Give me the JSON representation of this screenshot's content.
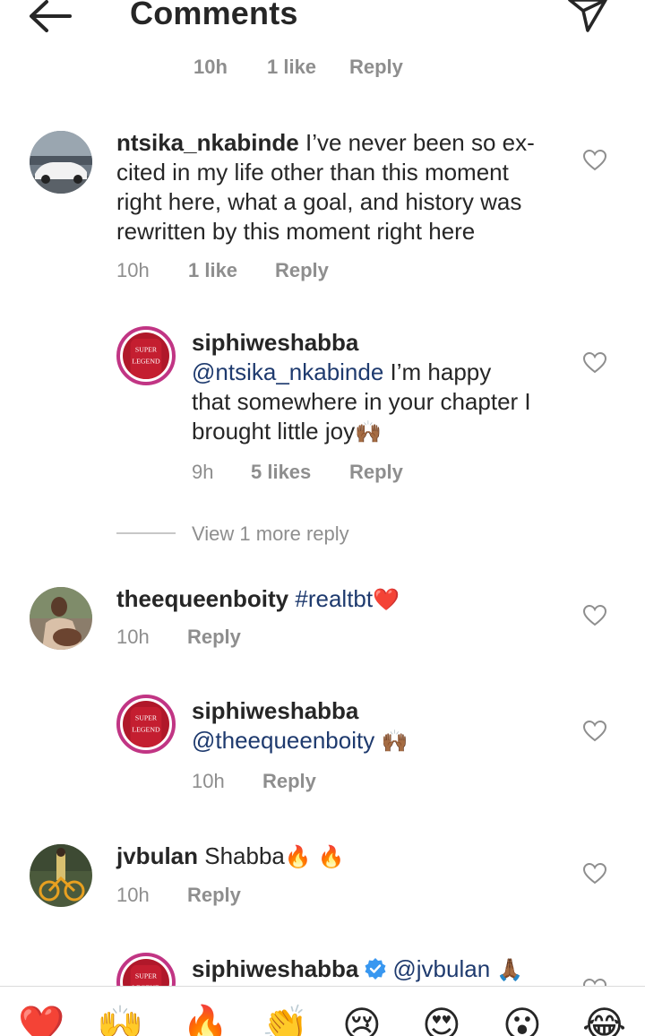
{
  "header": {
    "title": "Comments"
  },
  "partial_meta": {
    "time": "10h",
    "likes": "1 like",
    "reply": "Reply"
  },
  "comments": [
    {
      "username": "ntsika_nkabinde",
      "lines": [
        "I’ve never been so ex-",
        "cited in my life other than this moment",
        "right here, what a goal, and history was",
        "rewritten by this moment right here"
      ],
      "time": "10h",
      "likes": "1 like",
      "reply": "Reply"
    },
    {
      "username": "siphiweshabba",
      "mention": "@ntsika_nkabinde",
      "text1": "I’m happy",
      "text2": "that somewhere in your chapter I",
      "text3": "brought little joy",
      "emoji": "🙌🏾",
      "time": "9h",
      "likes": "5 likes",
      "reply": "Reply"
    },
    {
      "username": "theequeenboity",
      "hashtag": "#realtbt",
      "emoji": "❤️",
      "time": "10h",
      "reply": "Reply"
    },
    {
      "username": "siphiweshabba",
      "mention": "@theequeenboity",
      "emoji": "🙌🏾",
      "time": "10h",
      "reply": "Reply"
    },
    {
      "username": "jvbulan",
      "text": "Shabba",
      "emoji": "🔥 🔥",
      "time": "10h",
      "reply": "Reply"
    },
    {
      "username": "siphiweshabba",
      "mention": "@jvbulan",
      "emoji": "🙏🏾"
    }
  ],
  "view_more": "View 1 more reply",
  "emoji_bar": [
    "❤️",
    "🙌",
    "🔥",
    "👏",
    "😢",
    "😍",
    "😮",
    "😂"
  ],
  "colors": {
    "text": "#262626",
    "secondary": "#8e8e8e",
    "mention": "#1e3a6e",
    "story_ring": "#c13584",
    "verified": "#3897f0"
  }
}
